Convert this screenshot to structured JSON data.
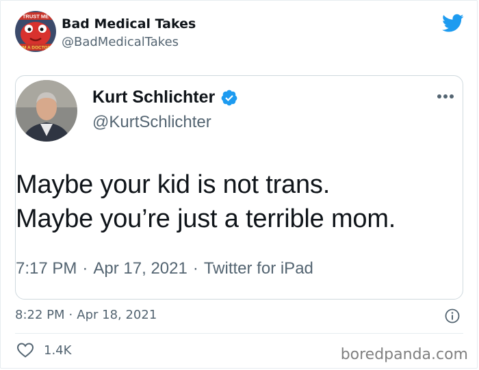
{
  "header": {
    "author_name": "Bad Medical Takes",
    "author_handle": "@BadMedicalTakes",
    "avatar_text_top": "TRUST ME",
    "avatar_text_bottom": "I'M A DOCTOR",
    "bird_icon": "twitter-bird-icon"
  },
  "quoted_tweet": {
    "author_name": "Kurt Schlichter",
    "author_handle": "@KurtSchlichter",
    "verified_icon": "verified-badge-icon",
    "more_icon": "more-options-icon",
    "text_lines": [
      "Maybe your kid is not trans.",
      "Maybe you’re just a terrible mom."
    ],
    "time": "7:17 PM",
    "date": "Apr 17, 2021",
    "source": "Twitter for iPad"
  },
  "tweet_meta": {
    "time": "8:22 PM",
    "date": "Apr 18, 2021",
    "info_icon": "info-icon"
  },
  "actions": {
    "like_icon": "heart-icon",
    "like_count": "1.4K"
  },
  "watermark": "boredpanda.com",
  "colors": {
    "twitter_blue": "#1d9bf0",
    "text_primary": "#0f1419",
    "text_secondary": "#536471",
    "border": "#cfd9de"
  }
}
